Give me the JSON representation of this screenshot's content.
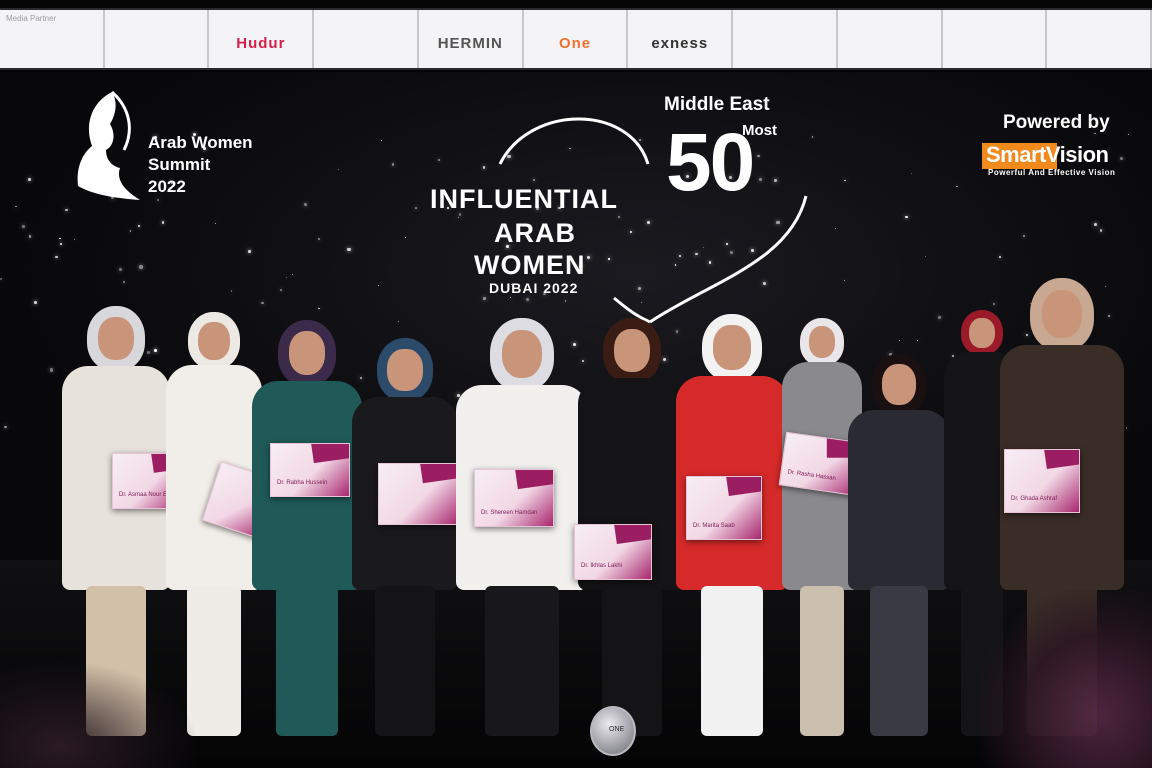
{
  "sponsors": [
    {
      "caption": "Media Partner",
      "logo": "",
      "color": "#1b3d8c"
    },
    {
      "caption": "",
      "logo": "",
      "color": "#b0306a"
    },
    {
      "caption": "",
      "logo": "Hudur",
      "color": "#d4204a"
    },
    {
      "caption": "",
      "logo": "",
      "color": "#2aa198"
    },
    {
      "caption": "",
      "logo": "HERMIN",
      "color": "#555555"
    },
    {
      "caption": "",
      "logo": "One",
      "color": "#f07030"
    },
    {
      "caption": "",
      "logo": "exness",
      "color": "#333333"
    },
    {
      "caption": "",
      "logo": "",
      "color": "#4a9ec8"
    },
    {
      "caption": "",
      "logo": "",
      "color": "#c0207a"
    },
    {
      "caption": "",
      "logo": "",
      "color": "#3a6ab8"
    },
    {
      "caption": "",
      "logo": "",
      "color": "#d02060"
    }
  ],
  "summit": {
    "name_line1": "Arab Women",
    "name_line2": "Summit",
    "year": "2022"
  },
  "headline": {
    "region": "Middle East",
    "most": "Most",
    "number": "50",
    "line1": "INFLUENTIAL",
    "line2": "ARAB",
    "line3": "WOMEN",
    "city": "DUBAI 2022"
  },
  "powered": {
    "label": "Powered by",
    "brand": "SmartVision",
    "tagline": "Powerful And Effective Vision"
  },
  "people": [
    {
      "name": "Dr. Asmaa Nour Eldin",
      "outfit": "#e8e2dc",
      "scarf": "#d8d8dc",
      "pants": "#d2c1a8"
    },
    {
      "name": "",
      "outfit": "#f1ede8",
      "scarf": "#ece8e4",
      "pants": "#efebe6"
    },
    {
      "name": "Dr. Rabha Hussein",
      "outfit": "#1f5a58",
      "scarf": "#3c2a4a",
      "pants": "#1f5a58"
    },
    {
      "name": "",
      "outfit": "#1a1a1e",
      "scarf": "#2c4a6a",
      "pants": "#141416"
    },
    {
      "name": "Dr. Shereen Hamdan",
      "outfit": "#f1f0ee",
      "scarf": "#dcdce2",
      "pants": "#18181a"
    },
    {
      "name": "Dr. Ikhlas Lakhi",
      "outfit": "#141416",
      "scarf": "#3a1c14",
      "pants": "#141416"
    },
    {
      "name": "Dr. Marita Saab",
      "outfit": "#d62a2a",
      "scarf": "#f2f2f2",
      "pants": "#f1f1f1"
    },
    {
      "name": "Dr. Rasha Hassan",
      "outfit": "#8a8a8e",
      "scarf": "#e8e6e8",
      "pants": "#cbbfae"
    },
    {
      "name": "",
      "outfit": "#2a2a32",
      "scarf": "#1a1012",
      "pants": "#3a3a44"
    },
    {
      "name": "",
      "outfit": "#141416",
      "scarf": "#9a1a2a",
      "pants": "#141416"
    },
    {
      "name": "Dr. Ghada Ashraf",
      "outfit": "#3a2c26",
      "scarf": "#c8a890",
      "pants": "#3a2c26"
    }
  ],
  "trophy": {
    "label": "ONE"
  }
}
